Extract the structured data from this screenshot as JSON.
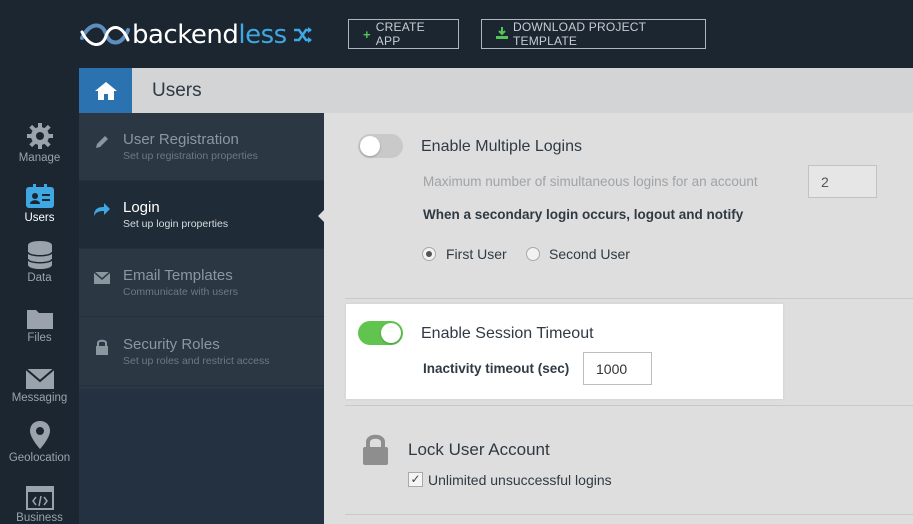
{
  "header": {
    "logo_text_main": "backend",
    "logo_text_accent": "less",
    "create_app_label": "CREATE APP",
    "download_label": "DOWNLOAD PROJECT TEMPLATE"
  },
  "leftnav": {
    "items": [
      {
        "label": "Manage",
        "icon": "gear-icon",
        "active": false
      },
      {
        "label": "Users",
        "icon": "users-card-icon",
        "active": true
      },
      {
        "label": "Data",
        "icon": "database-icon",
        "active": false
      },
      {
        "label": "Files",
        "icon": "folder-icon",
        "active": false
      },
      {
        "label": "Messaging",
        "icon": "envelope-icon",
        "active": false
      },
      {
        "label": "Geolocation",
        "icon": "map-pin-icon",
        "active": false
      },
      {
        "label": "Business",
        "icon": "code-icon",
        "active": false
      }
    ]
  },
  "titlebar": {
    "home_icon": "home-icon",
    "title": "Users"
  },
  "submenu": {
    "items": [
      {
        "title": "User Registration",
        "desc": "Set up registration properties",
        "icon": "pencil-icon",
        "active": false
      },
      {
        "title": "Login",
        "desc": "Set up login properties",
        "icon": "share-arrow-icon",
        "active": true
      },
      {
        "title": "Email Templates",
        "desc": "Communicate with users",
        "icon": "envelope-icon",
        "active": false
      },
      {
        "title": "Security Roles",
        "desc": "Set up roles and restrict access",
        "icon": "lock-icon",
        "active": false
      }
    ]
  },
  "multiple_logins": {
    "label": "Enable Multiple Logins",
    "enabled": false,
    "max_label": "Maximum number of simultaneous logins for an account",
    "max_value": "2",
    "secondary_label": "When a secondary login occurs, logout and notify",
    "options": [
      "First User",
      "Second User"
    ],
    "selected": "First User"
  },
  "session_timeout": {
    "label": "Enable Session Timeout",
    "enabled": true,
    "inactivity_label": "Inactivity timeout (sec)",
    "inactivity_value": "1000"
  },
  "lock_account": {
    "label": "Lock User Account",
    "checkbox_label": "Unlimited unsuccessful logins",
    "checked": true
  },
  "colors": {
    "topbar": "#1b2631",
    "accent_blue": "#2b73b0",
    "toggle_on": "#60c44f",
    "submenu_bg": "#2b3844"
  }
}
